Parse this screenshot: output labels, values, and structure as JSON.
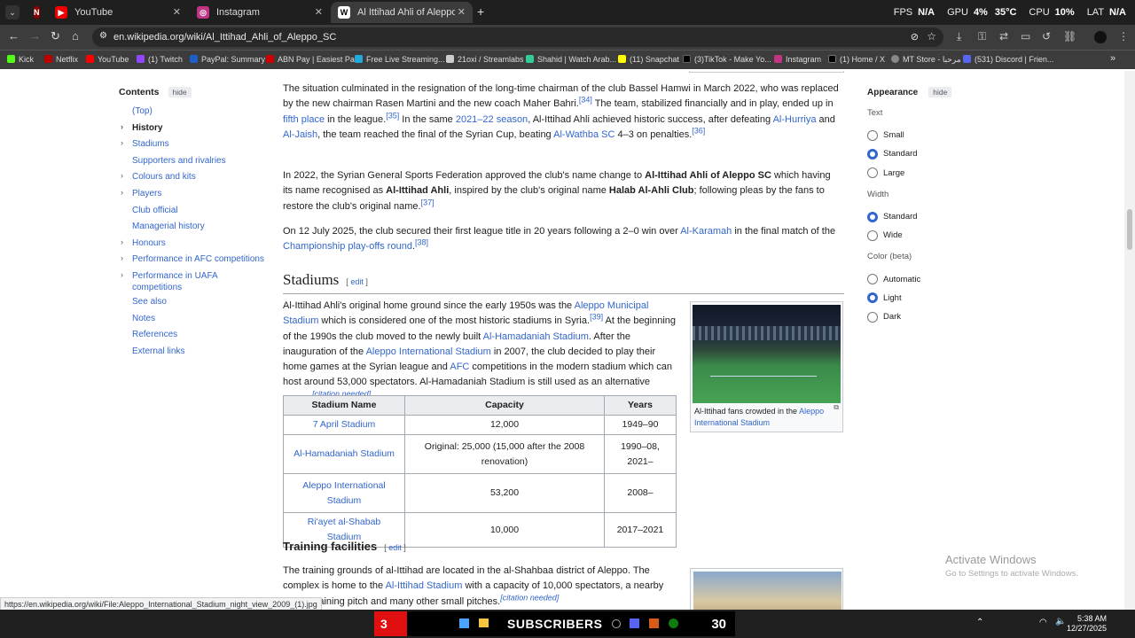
{
  "tabs": [
    {
      "label": "",
      "icon": "netflix-icon"
    },
    {
      "label": "YouTube",
      "icon": "youtube-icon"
    },
    {
      "label": "Instagram",
      "icon": "instagram-icon"
    },
    {
      "label": "Al Ittihad Ahli of Aleppo SC - W",
      "icon": "wikipedia-icon"
    }
  ],
  "stats": {
    "fps_label": "FPS",
    "fps_value": "N/A",
    "gpu_label": "GPU",
    "gpu_value": "4%",
    "gpu_temp": "35°C",
    "cpu_label": "CPU",
    "cpu_value": "10%",
    "lat_label": "LAT",
    "lat_value": "N/A"
  },
  "address": {
    "url": "en.wikipedia.org/wiki/Al_Ittihad_Ahli_of_Aleppo_SC"
  },
  "bookmarks": [
    "Kick",
    "Netflix",
    "YouTube",
    "(1) Twitch",
    "PayPal: Summary",
    "ABN Pay | Easiest Pa...",
    "Free Live Streaming...",
    "21oxi / Streamlabs",
    "Shahid | Watch Arab...",
    "(11) Snapchat",
    "(3)TikTok - Make Yo...",
    "Instagram",
    "(1) Home / X",
    "MT Store - مرحبا",
    "(531) Discord | Frien..."
  ],
  "toc": {
    "title": "Contents",
    "hide": "hide",
    "items": [
      "(Top)",
      "History",
      "Stadiums",
      "Supporters and rivalries",
      "Colours and kits",
      "Players",
      "Club official",
      "Managerial history",
      "Honours",
      "Performance in AFC competitions",
      "Performance in UAFA competitions",
      "See also",
      "Notes",
      "References",
      "External links"
    ]
  },
  "history": {
    "p1a": "The situation culminated in the resignation of the long-time chairman of the club Bassel Hamwi in March 2022, who was replaced by the new chairman Rasen Martini and the new coach Maher Bahri.",
    "ref34": "[34]",
    "p1b": " The team, stabilized financially and in play, ended up in ",
    "fifth": "fifth place",
    "p1c": " in the league.",
    "ref35": "[35]",
    "p1d": " In the same ",
    "season": "2021–22 season",
    "p1e": ", Al-Ittihad Ahli achieved historic success, after defeating ",
    "hurriya": "Al-Hurriya",
    "and": " and ",
    "jaish": "Al-Jaish",
    "p1f": ", the team reached the final of the Syrian Cup, beating ",
    "wathba": "Al-Wathba SC",
    "p1g": " 4–3 on penalties.",
    "ref36": "[36]",
    "p2a": "In 2022, the Syrian General Sports Federation approved the club's name change to ",
    "p2b": "Al-Ittihad Ahli of Aleppo SC",
    "p2c": " which having its name recognised as ",
    "p2d": "Al-Ittihad Ahli",
    "p2e": ", inspired by the club's original name ",
    "p2f": "Halab Al-Ahli Club",
    "p2g": "; following pleas by the fans to restore the club's original name.",
    "ref37": "[37]",
    "p3a": "On 12 July 2025, the club secured their first league title in 20 years following a 2–0 win over ",
    "karamah": "Al-Karamah",
    "p3b": " in the final match of the ",
    "champ": "Championship play-offs round",
    "p3c": ".",
    "ref38": "[38]"
  },
  "stadiums": {
    "heading": "Stadiums",
    "edit": "edit",
    "p1": "Al-Ittihad Ahli's original home ground since the early 1950s was the ",
    "municipal": "Aleppo Municipal Stadium",
    "p2": " which is considered one of the most historic stadiums in Syria.",
    "ref39": "[39]",
    "p3": " At the beginning of the 1990s the club moved to the newly built ",
    "hamadaniah": "Al-Hamadaniah Stadium",
    "p4": ". After the inauguration of the ",
    "intl": "Aleppo International Stadium",
    "p5": " in 2007, the club decided to play their home games at the Syrian league and ",
    "afc": "AFC",
    "p6": " competitions in the modern stadium which can host around 53,000 spectators. Al-Hamadaniah Stadium is still used as an alternative venue.",
    "cite": "[citation needed]",
    "caption": "Al-Ittihad fans crowded in the ",
    "caption_link": "Aleppo International Stadium",
    "table": {
      "headers": [
        "Stadium Name",
        "Capacity",
        "Years"
      ],
      "rows": [
        [
          "7 April Stadium",
          "12,000",
          "1949–90"
        ],
        [
          "Al-Hamadaniah Stadium",
          "Original: 25,000 (15,000 after the 2008 renovation)",
          "1990–08, 2021–"
        ],
        [
          "Aleppo International Stadium",
          "53,200",
          "2008–"
        ],
        [
          "Ri'ayet al-Shabab Stadium",
          "10,000",
          "2017–2021"
        ]
      ]
    }
  },
  "training": {
    "heading": "Training facilities",
    "edit": "edit",
    "p1": "The training grounds of al-Ittihad are located in the al-Shahbaa district of Aleppo. The complex is home to the ",
    "link": "Al-Ittihad Stadium",
    "p2": " with a capacity of 10,000 spectators, a nearby indoor training pitch and many other small pitches.",
    "cite": "[citation needed]"
  },
  "appearance": {
    "title": "Appearance",
    "hide": "hide",
    "text_label": "Text",
    "text_opts": [
      "Small",
      "Standard",
      "Large"
    ],
    "width_label": "Width",
    "width_opts": [
      "Standard",
      "Wide"
    ],
    "color_label": "Color (beta)",
    "color_opts": [
      "Automatic",
      "Light",
      "Dark"
    ]
  },
  "status_url": "https://en.wikipedia.org/wiki/File:Aleppo_International_Stadium_night_view_2009_(1).jpg",
  "watermark": {
    "title": "Activate Windows",
    "sub": "Go to Settings to activate Windows."
  },
  "taskbar": {
    "subs_num": "3",
    "subs_label": "SUBSCRIBERS",
    "subs_count": "30",
    "time": "5:38 AM",
    "date": "12/27/2025"
  }
}
